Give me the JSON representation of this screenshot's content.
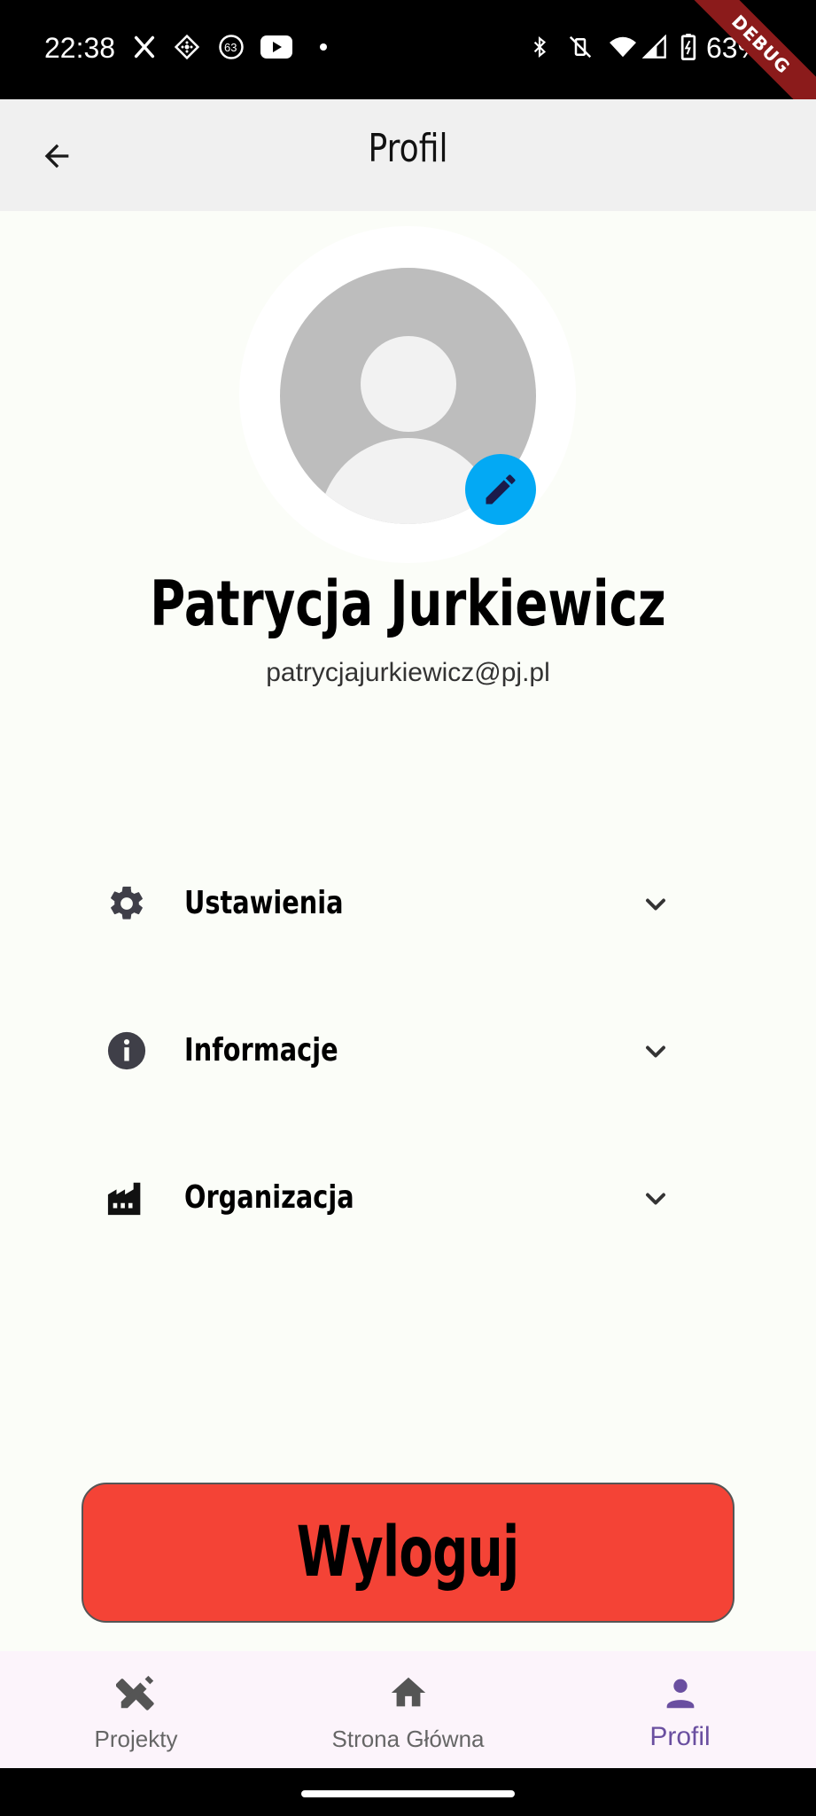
{
  "status_bar": {
    "time": "22:38",
    "battery": "63%",
    "notification_badge": "63",
    "debug_banner": "DEBUG"
  },
  "app_bar": {
    "title": "Profil",
    "back_icon": "arrow-back-icon"
  },
  "profile": {
    "name": "Patrycja Jurkiewicz",
    "email": "patrycjajurkiewicz@pj.pl",
    "edit_icon": "pencil-icon"
  },
  "menu": {
    "items": [
      {
        "label": "Ustawienia",
        "icon": "gear-icon"
      },
      {
        "label": "Informacje",
        "icon": "info-icon"
      },
      {
        "label": "Organizacja",
        "icon": "factory-icon"
      }
    ]
  },
  "logout": {
    "label": "Wyloguj",
    "color": "#F44336"
  },
  "bottom_nav": {
    "items": [
      {
        "label": "Projekty",
        "icon": "design-tools-icon"
      },
      {
        "label": "Strona Główna",
        "icon": "home-icon"
      },
      {
        "label": "Profil",
        "icon": "person-icon",
        "active": true
      }
    ],
    "active_color": "#6A4FA0"
  },
  "colors": {
    "background": "#FBFDF8",
    "app_bar": "#F0F0F0",
    "edit_button": "#03A9F4"
  }
}
